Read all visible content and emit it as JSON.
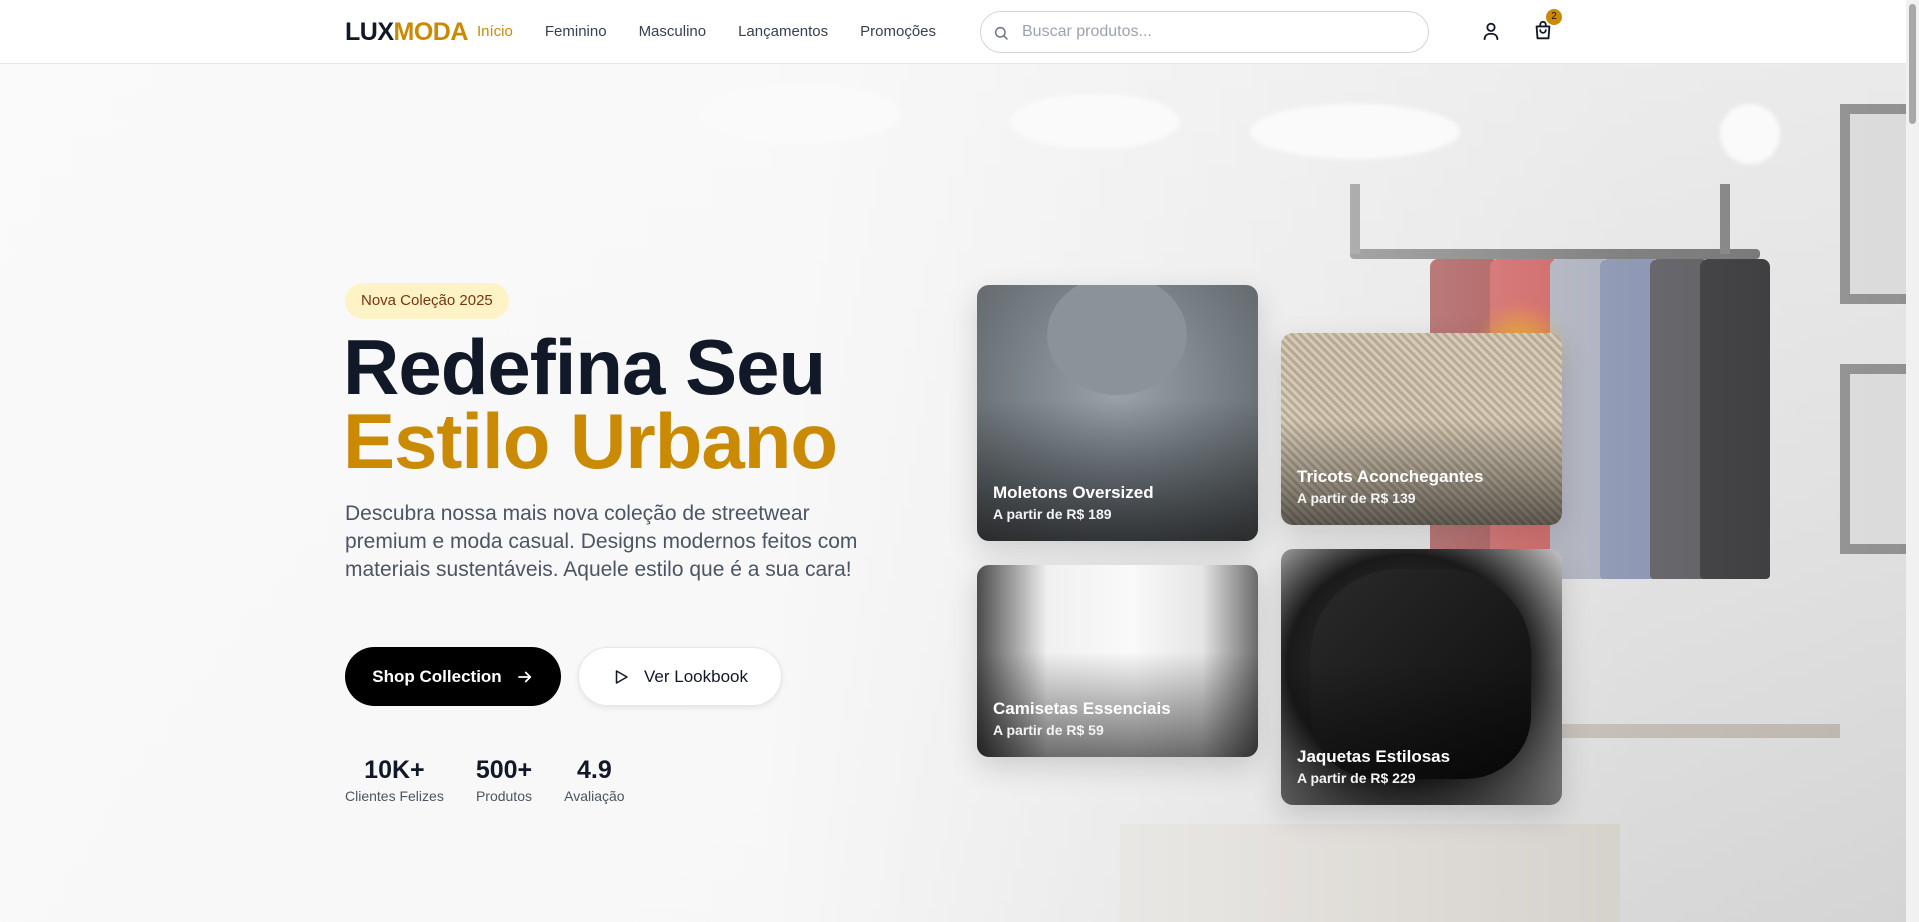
{
  "brand": {
    "part1": "LUX",
    "part2": "MODA"
  },
  "nav": [
    {
      "label": "Início",
      "active": true
    },
    {
      "label": "Feminino",
      "active": false
    },
    {
      "label": "Masculino",
      "active": false
    },
    {
      "label": "Lançamentos",
      "active": false
    },
    {
      "label": "Promoções",
      "active": false
    }
  ],
  "search": {
    "placeholder": "Buscar produtos...",
    "value": "",
    "icon": "search-icon"
  },
  "header_icons": {
    "user": "user-icon",
    "cart": "shopping-bag-icon",
    "cart_count": "2"
  },
  "hero": {
    "badge": "Nova Coleção 2025",
    "title_line1": "Redefina Seu",
    "title_line2": "Estilo Urbano",
    "description": "Descubra nossa mais nova coleção de streetwear premium e moda casual. Designs modernos feitos com materiais sustentáveis. Aquele estilo que é a sua cara!",
    "primary_button": "Shop Collection",
    "secondary_button": "Ver Lookbook"
  },
  "stats": [
    {
      "value": "10K+",
      "label": "Clientes Felizes"
    },
    {
      "value": "500+",
      "label": "Produtos"
    },
    {
      "value": "4.9",
      "label": "Avaliação"
    }
  ],
  "products": [
    {
      "title": "Moletons Oversized",
      "price": "A partir de R$ 189"
    },
    {
      "title": "Tricots Aconchegantes",
      "price": "A partir de R$ 139"
    },
    {
      "title": "Camisetas Essenciais",
      "price": "A partir de R$ 59"
    },
    {
      "title": "Jaquetas Estilosas",
      "price": "A partir de R$ 229"
    }
  ],
  "colors": {
    "accent": "#ca8a04",
    "dark": "#111827",
    "badge_bg": "#fef3c7"
  }
}
